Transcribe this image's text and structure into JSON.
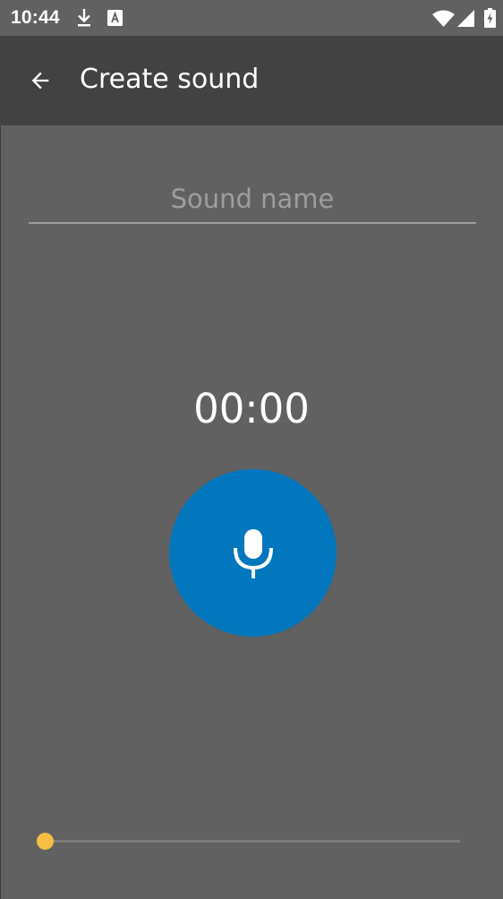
{
  "status_bar": {
    "time": "10:44",
    "icons": [
      "download-icon",
      "font-a-icon",
      "wifi-icon",
      "signal-icon",
      "battery-charging-icon"
    ]
  },
  "app_bar": {
    "back_icon": "arrow-back-icon",
    "title": "Create sound"
  },
  "sound_name": {
    "value": "",
    "placeholder": "Sound name"
  },
  "timer": "00:00",
  "record_button": {
    "icon": "microphone-icon"
  },
  "seekbar": {
    "progress": 0
  },
  "colors": {
    "background": "#616161",
    "app_bar": "#424242",
    "accent": "#0277bd",
    "thumb": "#f4bf42"
  }
}
